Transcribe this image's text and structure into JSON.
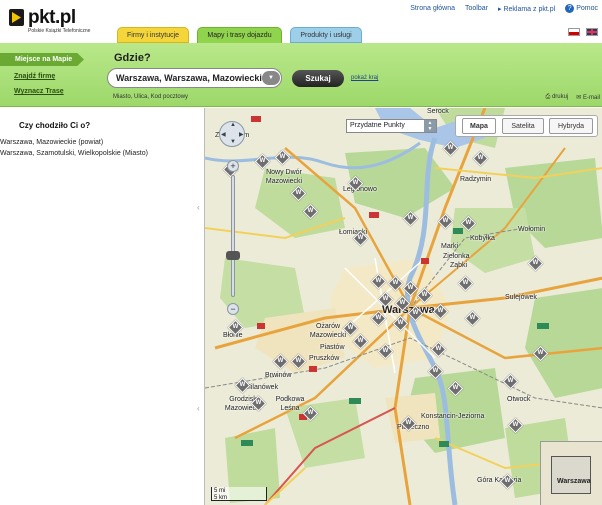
{
  "header": {
    "logo_text": "pkt.pl",
    "logo_sub": "Polskie Książki Telefoniczne",
    "links": {
      "home": "Strona główna",
      "toolbar": "Toolbar",
      "ads": "Reklama z pkt.pl",
      "help": "Pomoc"
    }
  },
  "tabs": {
    "firmy": "Firmy i instytucje",
    "mapy": "Mapy i trasy dojazdu",
    "produkty": "Produkty i usługi"
  },
  "nav": {
    "active": "Miejsce na Mapie",
    "find_company": "Znajdź firmę",
    "route": "Wyznacz Trasę"
  },
  "search": {
    "label": "Gdzie?",
    "value": "Warszawa, Warszawa, Mazowieckie",
    "hint": "Miasto, Ulica, Kod pocztowy",
    "button": "Szukaj",
    "show_country": "pokaż kraj",
    "print": "drukuj",
    "email": "E-mail"
  },
  "suggestions": {
    "question": "Czy chodziło Ci o?",
    "items": [
      "Warszawa, Mazowieckie (powiat)",
      "Warszawa, Szamotulski, Wielkopolskie (Miasto)"
    ]
  },
  "map": {
    "poi_select": "Przydatne Punkty",
    "types": {
      "map": "Mapa",
      "satellite": "Satelita",
      "hybrid": "Hybryda"
    },
    "scale_mi": "5 mi",
    "scale_km": "5 km",
    "overview_label": "Warszawa",
    "labels": {
      "serock": "Serock",
      "zakroczym": "Zakroczym",
      "nowy_dwor": "Nowy Dwór Mazowiecki",
      "legionowo": "Legionowo",
      "radzymin": "Radzymin",
      "lomianki": "Łomianki",
      "wolomin": "Wołomin",
      "marki": "Marki",
      "kobylka": "Kobyłka",
      "zabki": "Ząbki",
      "zielonka": "Zielonka",
      "sulejowek": "Sulejówek",
      "warszawa": "Warszawa",
      "blonie": "Błonie",
      "ozarow": "Ożarów Mazowiecki",
      "piastow": "Piastów",
      "pruszkow": "Pruszków",
      "otwock": "Otwock",
      "brwinow": "Brwinów",
      "milanowek": "Milanówek",
      "grodzisk": "Grodzisk Mazowiecki",
      "podkowa": "Podkowa Leśna",
      "konstancin": "Konstancin-Jeziorna",
      "piaseczno": "Piaseczno",
      "gora": "Góra Kalwaria"
    }
  }
}
